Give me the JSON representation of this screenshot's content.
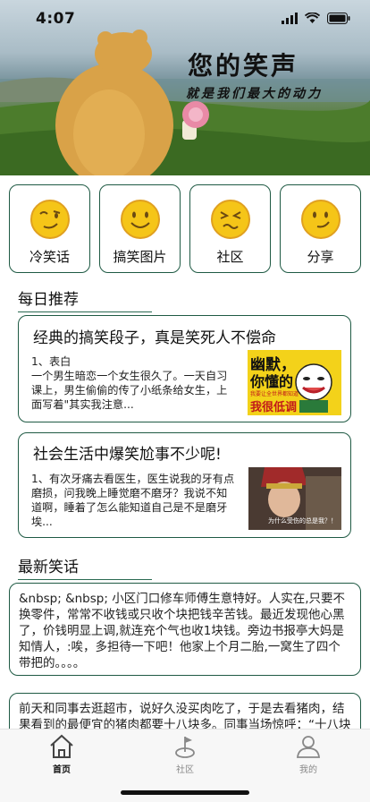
{
  "status_bar": {
    "time": "4:07"
  },
  "banner": {
    "title": "您的笑声",
    "subtitle": "就是我们最大的动力"
  },
  "categories": [
    {
      "label": "冷笑话",
      "icon": "smirk-face-icon"
    },
    {
      "label": "搞笑图片",
      "icon": "smile-face-icon"
    },
    {
      "label": "社区",
      "icon": "squint-face-icon"
    },
    {
      "label": "分享",
      "icon": "wry-smile-face-icon"
    }
  ],
  "daily": {
    "section_title": "每日推荐",
    "cards": [
      {
        "title": "经典的搞笑段子，真是笑死人不偿命",
        "body": "1、表白\n一个男生暗恋一个女生很久了。一天自习课上，男生偷偷的传了小纸条给女生，上面写着\"其实我注意...",
        "thumb_text_top": "幽默，",
        "thumb_text_mid": "你懂的",
        "thumb_text_small": "我要让全世界都知道",
        "thumb_text_bottom": "我很低调"
      },
      {
        "title": "社会生活中爆笑尬事不少呢!",
        "body": "1、有次牙痛去看医生，医生说我的牙有点磨损，问我晚上睡觉磨不磨牙？我说不知道啊，睡着了怎么能知道自己是不是磨牙埃...",
        "thumb_caption": "为什么受伤的总是我？！"
      }
    ]
  },
  "latest": {
    "section_title": "最新笑话",
    "jokes": [
      "&nbsp; &nbsp; 小区门口修车师傅生意特好。人实在,只要不换零件，常常不收钱或只收个块把钱辛苦钱。最近发现他心黑了，价钱明显上调,就连充个气也收1块钱。旁边书报亭大妈是知情人，:唉，多担待一下吧！他家上个月二胎,一窝生了四个带把的。。。。",
      "前天和同事去逛超市，说好久没买肉吃了，于是去看猪肉，结果看到的最便宜的猪肉都要十八块多。同事当场惊呼：“十八块多！”"
    ]
  },
  "tabbar": {
    "items": [
      {
        "label": "首页",
        "icon": "home-icon",
        "active": true
      },
      {
        "label": "社区",
        "icon": "community-icon",
        "active": false
      },
      {
        "label": "我的",
        "icon": "profile-icon",
        "active": false
      }
    ]
  },
  "colors": {
    "accent": "#1f5a44",
    "face_yellow": "#f5c518",
    "face_outline": "#e0a020"
  }
}
